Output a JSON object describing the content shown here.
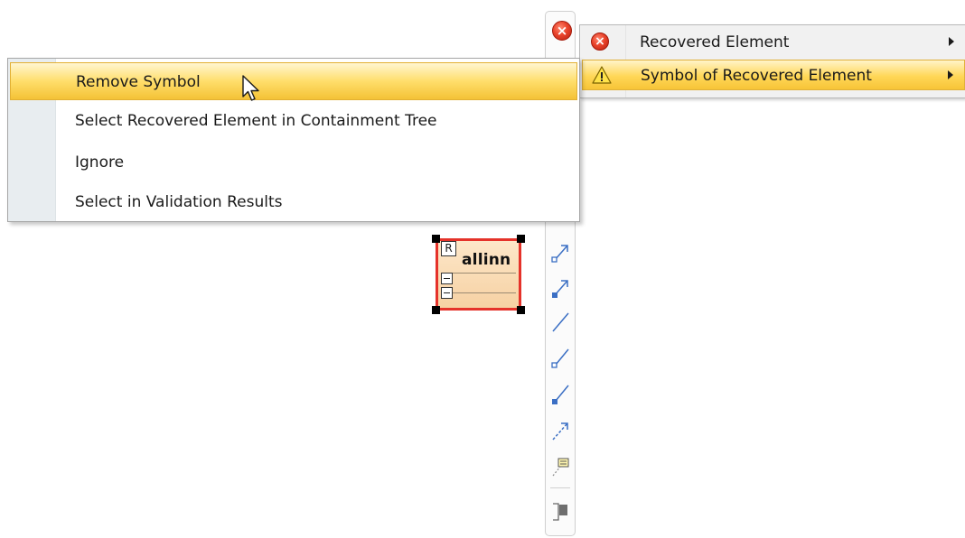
{
  "context_menu": {
    "items": [
      {
        "label": "Remove Symbol",
        "highlighted": true
      },
      {
        "label": "Select Recovered Element in Containment Tree",
        "highlighted": false
      },
      {
        "label": "Ignore",
        "highlighted": false
      },
      {
        "label": "Select in Validation Results",
        "highlighted": false
      }
    ]
  },
  "submenu": {
    "items": [
      {
        "label": "Recovered Element",
        "icon": "error-icon",
        "highlighted": false
      },
      {
        "label": "Symbol of Recovered Element",
        "icon": "warning-icon",
        "highlighted": true
      }
    ]
  },
  "diagram": {
    "element": {
      "title": "allinn",
      "badge": "R"
    }
  },
  "toolbar": {
    "tools": [
      "association-icon",
      "aggregation-icon",
      "composition-icon",
      "line-icon",
      "open-end-line-icon",
      "filled-end-line-icon",
      "dashed-arrow-icon",
      "note-link-icon",
      "shape-icon"
    ]
  },
  "colors": {
    "highlight": "#ffd757",
    "error": "#e9432b",
    "element_border": "#e5322a",
    "element_fill": "#f6d1a3",
    "tool_blue": "#3b6fc4"
  }
}
